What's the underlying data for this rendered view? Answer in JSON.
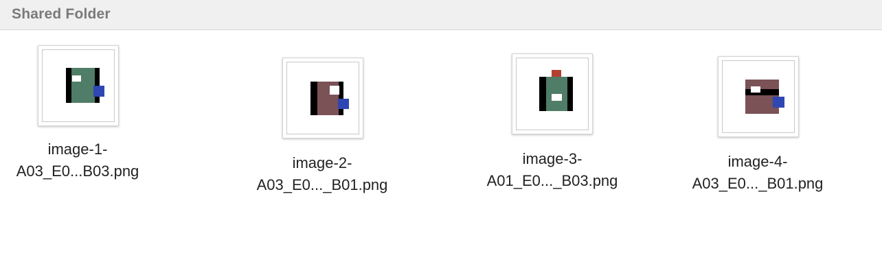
{
  "window": {
    "title": "Shared Folder"
  },
  "files": [
    {
      "name_line1": "image-1-",
      "name_line2": "A03_E0...B03.png",
      "thumbnail_icon": "image-thumbnail-icon"
    },
    {
      "name_line1": "image-2-",
      "name_line2": "A03_E0..._B01.png",
      "thumbnail_icon": "image-thumbnail-icon"
    },
    {
      "name_line1": "image-3-",
      "name_line2": "A01_E0..._B03.png",
      "thumbnail_icon": "image-thumbnail-icon"
    },
    {
      "name_line1": "image-4-",
      "name_line2": "A03_E0..._B01.png",
      "thumbnail_icon": "image-thumbnail-icon"
    }
  ],
  "colors": {
    "green": "#4f7d67",
    "brown": "#7b5256",
    "blue": "#2e47b3",
    "red": "#b24031",
    "black": "#000000",
    "white": "#ffffff"
  }
}
